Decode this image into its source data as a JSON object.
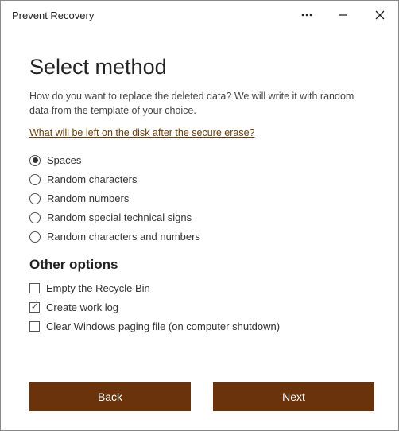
{
  "window": {
    "title": "Prevent Recovery"
  },
  "page": {
    "heading": "Select method",
    "description": "How do you want to replace the deleted data? We will write it with random data from the template of your choice.",
    "link_text": "What will be left on the disk after the secure erase?"
  },
  "methods": [
    {
      "label": "Spaces",
      "selected": true
    },
    {
      "label": "Random characters",
      "selected": false
    },
    {
      "label": "Random numbers",
      "selected": false
    },
    {
      "label": "Random special technical signs",
      "selected": false
    },
    {
      "label": "Random characters and numbers",
      "selected": false
    }
  ],
  "other_heading": "Other options",
  "other_options": [
    {
      "label": "Empty the Recycle Bin",
      "checked": false
    },
    {
      "label": "Create work log",
      "checked": true
    },
    {
      "label": "Clear Windows paging file (on computer shutdown)",
      "checked": false
    }
  ],
  "buttons": {
    "back": "Back",
    "next": "Next"
  },
  "colors": {
    "accent": "#6A330B",
    "link": "#6B3E0C"
  }
}
